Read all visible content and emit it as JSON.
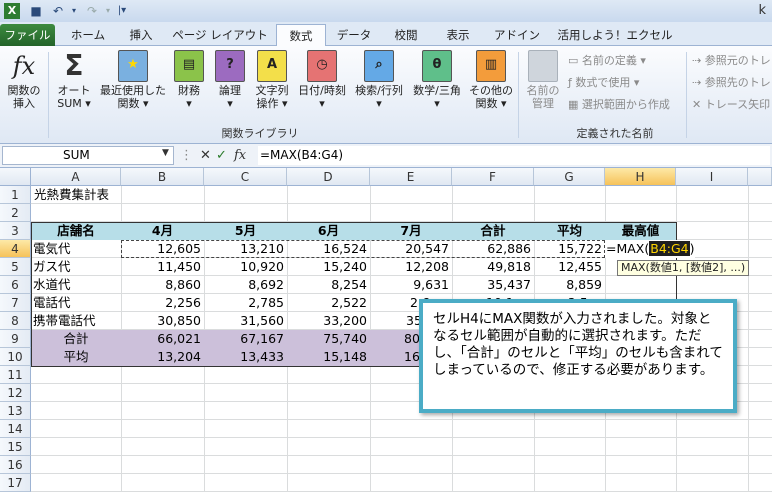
{
  "title_partial": "k",
  "tabs": [
    "ファイル",
    "ホーム",
    "挿入",
    "ページ レイアウト",
    "数式",
    "データ",
    "校閲",
    "表示",
    "アドイン",
    "活用しよう！エクセル"
  ],
  "active_tab": "数式",
  "ribbon": {
    "insert_function": "関数の\n挿入",
    "autosum": "オート\nSUM ▾",
    "recent": "最近使用した\n関数 ▾",
    "financial": "財務\n▾",
    "logical": "論理\n▾",
    "text": "文字列\n操作 ▾",
    "datetime": "日付/時刻\n▾",
    "lookup": "検索/行列\n▾",
    "math": "数学/三角\n▾",
    "more": "その他の\n関数 ▾",
    "group_function_library": "関数ライブラリ",
    "name_manager": "名前の\n管理",
    "define_name": "名前の定義 ▾",
    "use_in_formula": "数式で使用 ▾",
    "create_from_selection": "選択範囲から作成",
    "group_defined_names": "定義された名前",
    "trace_precedents": "参照元のトレ",
    "trace_dependents": "参照先のトレ",
    "remove_arrows": "トレース矢印"
  },
  "formula_bar": {
    "name_box": "SUM",
    "formula": "=MAX(B4:G4)"
  },
  "columns": [
    "A",
    "B",
    "C",
    "D",
    "E",
    "F",
    "G",
    "H",
    "I"
  ],
  "rows": [
    "1",
    "2",
    "3",
    "4",
    "5",
    "6",
    "7",
    "8",
    "9",
    "10",
    "11",
    "12",
    "13",
    "14",
    "15",
    "16",
    "17"
  ],
  "sheet": {
    "title": "光熱費集計表",
    "headers": [
      "店舗名",
      "4月",
      "5月",
      "6月",
      "7月",
      "合計",
      "平均",
      "最高値"
    ],
    "data": [
      [
        "電気代",
        "12,605",
        "13,210",
        "16,524",
        "20,547",
        "62,886",
        "15,722"
      ],
      [
        "ガス代",
        "11,450",
        "10,920",
        "15,240",
        "12,208",
        "49,818",
        "12,455"
      ],
      [
        "水道代",
        "8,860",
        "8,692",
        "8,254",
        "9,631",
        "35,437",
        "8,859"
      ],
      [
        "電話代",
        "2,256",
        "2,785",
        "2,522",
        "2,6",
        "10,1",
        "2,5"
      ],
      [
        "携帯電話代",
        "30,850",
        "31,560",
        "33,200",
        "35",
        "",
        ""
      ]
    ],
    "summary": [
      [
        "合計",
        "66,021",
        "67,167",
        "75,740",
        "80",
        "",
        ""
      ],
      [
        "平均",
        "13,204",
        "13,433",
        "15,148",
        "16",
        "",
        ""
      ]
    ]
  },
  "editing": {
    "prefix": "=MAX(",
    "range": "B4:G4",
    "suffix": ")",
    "tooltip": "MAX(数値1, [数値2], ...)"
  },
  "callout_text": "セルH4にMAX関数が入力されました。対象となるセル範囲が自動的に選択されます。ただし、「合計」のセルと「平均」のセルも含まれてしまっているので、修正する必要があります。",
  "colors": {
    "header_fill": "#b7dee8",
    "summary_fill": "#ccc0da",
    "callout_border": "#4bacc6",
    "file_tab": "#2c6c2f"
  }
}
